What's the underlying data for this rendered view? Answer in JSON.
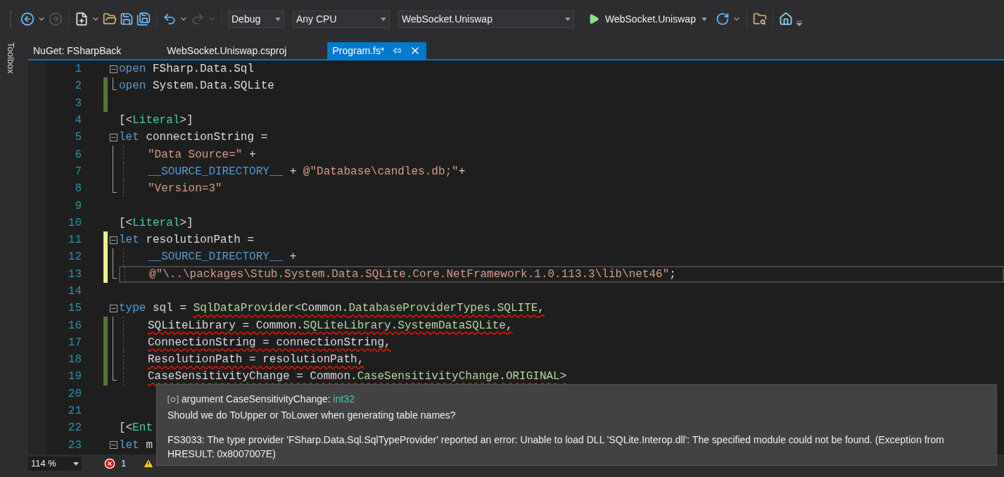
{
  "toolbar": {
    "configuration": "Debug",
    "platform": "Any CPU",
    "startup_project": "WebSocket.Uniswap",
    "run_target": "WebSocket.Uniswap",
    "forward_disabled": true,
    "redo_disabled": true
  },
  "toolbox_label": "Toolbox",
  "tabs": [
    {
      "label": "NuGet: FSharpBack",
      "selected": false
    },
    {
      "label": "WebSocket.Uniswap.csproj",
      "selected": false
    },
    {
      "label": "Program.fs*",
      "selected": true
    }
  ],
  "editor": {
    "lines": [
      {
        "number": "1",
        "fold_start": true,
        "tokens": [
          {
            "kind": "keyword",
            "text": "open",
            "error": false
          },
          {
            "kind": "text",
            "text": " FSharp.Data.Sql",
            "error": false
          }
        ]
      },
      {
        "number": "2",
        "changed": true,
        "saved": true,
        "fold_end": true,
        "tokens": [
          {
            "kind": "keyword",
            "text": "open",
            "error": false
          },
          {
            "kind": "text",
            "text": " System.Data.SQLite",
            "error": false
          }
        ]
      },
      {
        "number": "3",
        "changed": true,
        "saved": true
      },
      {
        "number": "4",
        "tokens": [
          {
            "kind": "text",
            "text": "[<",
            "error": false
          },
          {
            "kind": "attribute",
            "text": "Literal",
            "error": false
          },
          {
            "kind": "text",
            "text": ">]",
            "error": false
          }
        ]
      },
      {
        "number": "5",
        "fold_start": true,
        "tokens": [
          {
            "kind": "keyword",
            "text": "let",
            "error": false
          },
          {
            "kind": "text",
            "text": " connectionString =",
            "error": false
          }
        ]
      },
      {
        "number": "6",
        "in_fold": true,
        "tokens": [
          {
            "kind": "string",
            "text": "\"Data Source=\"",
            "error": false
          },
          {
            "kind": "text",
            "text": " +",
            "error": false
          }
        ]
      },
      {
        "number": "7",
        "in_fold": true,
        "tokens": [
          {
            "kind": "macro",
            "text": "__SOURCE_DIRECTORY__",
            "error": false
          },
          {
            "kind": "text",
            "text": " + ",
            "error": false
          },
          {
            "kind": "string",
            "text": "@\"Database\\candles.db;\"",
            "error": false
          },
          {
            "kind": "text",
            "text": "+",
            "error": false
          }
        ]
      },
      {
        "number": "8",
        "fold_end": true,
        "tokens": [
          {
            "kind": "string",
            "text": "\"Version=3\"",
            "error": false
          }
        ]
      },
      {
        "number": "9"
      },
      {
        "number": "10",
        "tokens": [
          {
            "kind": "text",
            "text": "[<",
            "error": false
          },
          {
            "kind": "attribute",
            "text": "Literal",
            "error": false
          },
          {
            "kind": "text",
            "text": ">]",
            "error": false
          }
        ]
      },
      {
        "number": "11",
        "changed": true,
        "saved": false,
        "fold_start": true,
        "tokens": [
          {
            "kind": "keyword",
            "text": "let",
            "error": false
          },
          {
            "kind": "text",
            "text": " resolutionPath =",
            "error": false
          }
        ]
      },
      {
        "number": "12",
        "changed": true,
        "saved": false,
        "in_fold": true,
        "tokens": [
          {
            "kind": "macro",
            "text": "__SOURCE_DIRECTORY__",
            "error": false
          },
          {
            "kind": "text",
            "text": " +",
            "error": false
          }
        ]
      },
      {
        "number": "13",
        "changed": true,
        "saved": false,
        "fold_end": true,
        "current": true,
        "tokens": [
          {
            "kind": "string",
            "text": "@\"\\..\\packages\\Stub.System.Data.SQLite.Core.NetFramework.1.0.113.3\\lib\\net46\"",
            "error": false
          },
          {
            "kind": "text",
            "text": ";",
            "error": false
          }
        ]
      },
      {
        "number": "14"
      },
      {
        "number": "15",
        "fold_start": true,
        "tokens": [
          {
            "kind": "keyword",
            "text": "type",
            "error": false
          },
          {
            "kind": "text",
            "text": " sql = ",
            "error": false
          },
          {
            "kind": "member",
            "text": "SqlDataProvider",
            "error": true
          },
          {
            "kind": "text",
            "text": "<Common.",
            "error": true
          },
          {
            "kind": "member",
            "text": "DatabaseProviderTypes",
            "error": true
          },
          {
            "kind": "text",
            "text": ".",
            "error": true
          },
          {
            "kind": "member",
            "text": "SQLITE",
            "error": true
          },
          {
            "kind": "text",
            "text": ",",
            "error": true
          }
        ]
      },
      {
        "number": "16",
        "changed": true,
        "saved": true,
        "in_fold": true,
        "tokens": [
          {
            "kind": "text",
            "text": "SQLiteLibrary = Common.",
            "error": true
          },
          {
            "kind": "member",
            "text": "SQLiteLibrary",
            "error": true
          },
          {
            "kind": "text",
            "text": ".",
            "error": true
          },
          {
            "kind": "member",
            "text": "SystemDataSQLite",
            "error": true
          },
          {
            "kind": "text",
            "text": ",",
            "error": true
          }
        ]
      },
      {
        "number": "17",
        "changed": true,
        "saved": true,
        "in_fold": true,
        "tokens": [
          {
            "kind": "text",
            "text": "ConnectionString = connectionString,",
            "error": true
          }
        ]
      },
      {
        "number": "18",
        "changed": true,
        "saved": true,
        "in_fold": true,
        "tokens": [
          {
            "kind": "text",
            "text": "ResolutionPath = resolutionPath,",
            "error": true
          }
        ]
      },
      {
        "number": "19",
        "changed": true,
        "saved": true,
        "fold_end": true,
        "tokens": [
          {
            "kind": "text",
            "text": "CaseSensitivityChange = Common.",
            "error": true
          },
          {
            "kind": "member",
            "text": "CaseSensitivityChange",
            "error": true
          },
          {
            "kind": "text",
            "text": ".",
            "error": true
          },
          {
            "kind": "member",
            "text": "ORIGINAL",
            "error": true
          },
          {
            "kind": "text",
            "text": ">",
            "error": true
          }
        ]
      },
      {
        "number": "20"
      },
      {
        "number": "21"
      },
      {
        "number": "22",
        "tokens": [
          {
            "kind": "text",
            "text": "[<",
            "error": false
          },
          {
            "kind": "attribute",
            "text": "Ent",
            "error": false
          }
        ]
      },
      {
        "number": "23",
        "fold_start": true,
        "tokens": [
          {
            "kind": "keyword",
            "text": "let",
            "error": false
          },
          {
            "kind": "text",
            "text": " m",
            "error": false
          }
        ]
      }
    ]
  },
  "tooltip": {
    "signature": "argument CaseSensitivityChange:",
    "type": "int32",
    "description": "Should we do ToUpper or ToLower when generating table names?",
    "error": "FS3033: The type provider 'FSharp.Data.Sql.SqlTypeProvider' reported an error: Unable to load DLL 'SQLite.Interop.dll': The specified module could not be found. (Exception from HRESULT: 0x8007007E)"
  },
  "status_bar": {
    "zoom": "114 %",
    "errors": "1"
  }
}
